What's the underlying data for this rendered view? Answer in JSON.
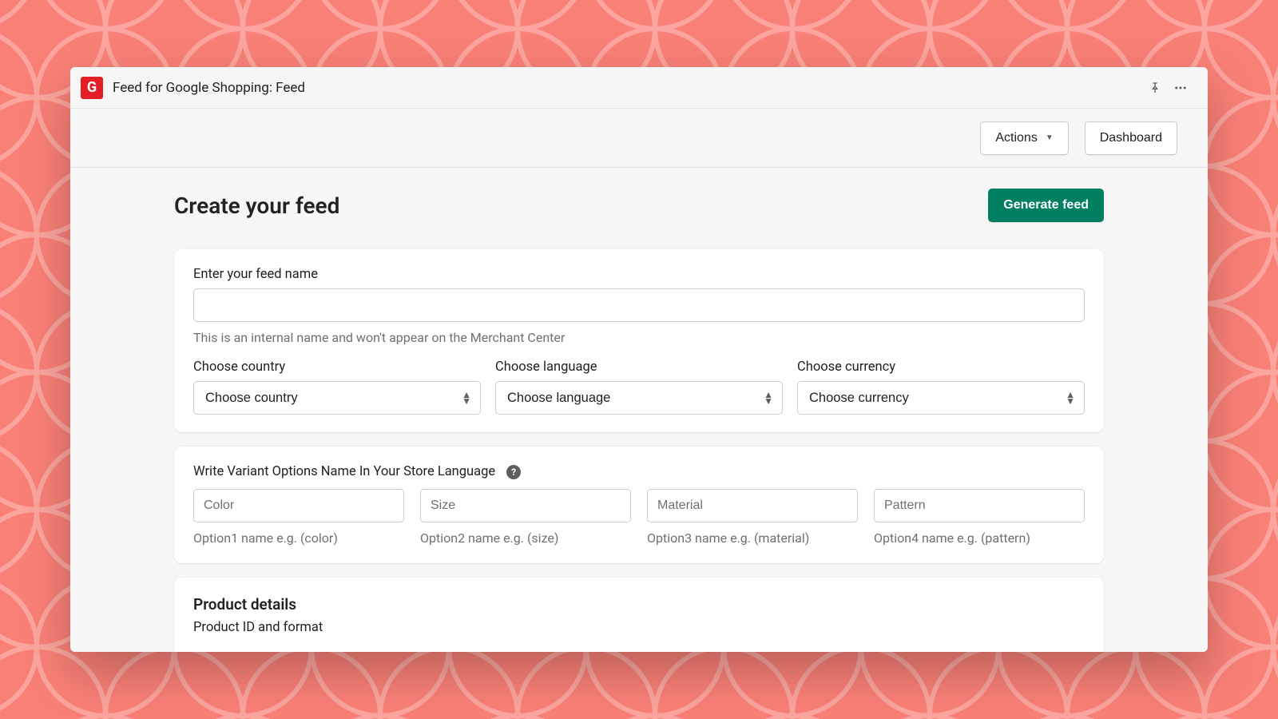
{
  "titlebar": {
    "badge_letter": "G",
    "title": "Feed for Google Shopping: Feed"
  },
  "toolbar": {
    "actions_label": "Actions",
    "dashboard_label": "Dashboard"
  },
  "page": {
    "title": "Create your feed",
    "generate_label": "Generate feed"
  },
  "feed_card": {
    "name_label": "Enter your feed name",
    "name_value": "",
    "name_helper": "This is an internal name and won't appear on the Merchant Center",
    "country_label": "Choose country",
    "country_value": "Choose country",
    "language_label": "Choose language",
    "language_value": "Choose language",
    "currency_label": "Choose currency",
    "currency_value": "Choose currency"
  },
  "variant_card": {
    "heading": "Write Variant Options Name In Your Store Language",
    "options": [
      {
        "placeholder": "Color",
        "hint": "Option1 name e.g. (color)"
      },
      {
        "placeholder": "Size",
        "hint": "Option2 name e.g. (size)"
      },
      {
        "placeholder": "Material",
        "hint": "Option3 name e.g. (material)"
      },
      {
        "placeholder": "Pattern",
        "hint": "Option4 name e.g. (pattern)"
      }
    ]
  },
  "product_card": {
    "title": "Product details",
    "subtitle": "Product ID and format"
  }
}
